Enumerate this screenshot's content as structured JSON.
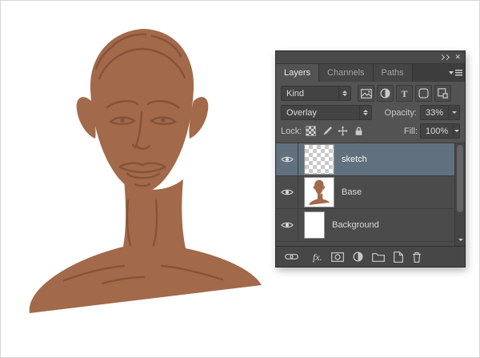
{
  "canvas": {
    "skin_color": "#a2694a",
    "sketch_line_color": "#7c4a31",
    "background_color": "#ffffff"
  },
  "panel": {
    "titlebar": {
      "icons": [
        "collapse-to-icons-icon",
        "close-icon"
      ]
    },
    "tabs": [
      {
        "label": "Layers",
        "active": true
      },
      {
        "label": "Channels",
        "active": false
      },
      {
        "label": "Paths",
        "active": false
      }
    ],
    "filter": {
      "kind_label": "Kind",
      "filter_icons": [
        "pixel-filter-icon",
        "adjustment-filter-icon",
        "type-filter-icon",
        "shape-filter-icon",
        "smart-object-filter-icon"
      ]
    },
    "blend": {
      "mode": "Overlay",
      "opacity_label": "Opacity:",
      "opacity_value": "33%"
    },
    "lock": {
      "label": "Lock:",
      "icons": [
        "lock-transparent-pixels-icon",
        "lock-image-pixels-icon",
        "lock-position-icon",
        "lock-all-icon"
      ],
      "fill_label": "Fill:",
      "fill_value": "100%"
    },
    "layers": [
      {
        "name": "sketch",
        "selected": true,
        "visible": true,
        "thumbnail": "transparent-checkerboard"
      },
      {
        "name": "Base",
        "selected": false,
        "visible": true,
        "thumbnail": "brown-portrait-on-white"
      },
      {
        "name": "Background",
        "selected": false,
        "visible": true,
        "thumbnail": "white"
      }
    ],
    "bottom_bar": {
      "fx_label": "fx.",
      "icons": [
        "link-layers-icon",
        "layer-style-icon",
        "add-layer-mask-icon",
        "new-adjustment-layer-icon",
        "new-group-icon",
        "new-layer-icon",
        "delete-layer-icon"
      ]
    },
    "colors": {
      "panel_bg": "#535353",
      "selected_layer_bg": "#60707f"
    }
  }
}
